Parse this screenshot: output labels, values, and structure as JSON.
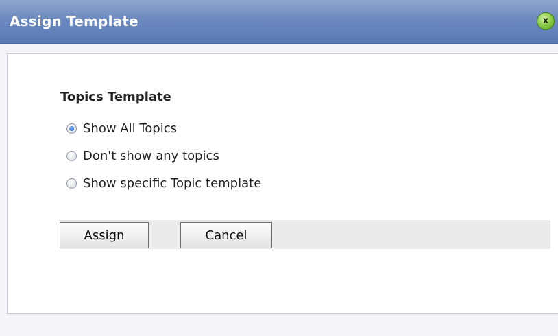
{
  "dialog": {
    "title": "Assign Template",
    "close_label": "x"
  },
  "section": {
    "title": "Topics Template",
    "options": [
      {
        "label": "Show All Topics",
        "checked": true
      },
      {
        "label": "Don't show any topics",
        "checked": false
      },
      {
        "label": "Show specific Topic template",
        "checked": false
      }
    ]
  },
  "buttons": {
    "assign": "Assign",
    "cancel": "Cancel"
  },
  "colors": {
    "titlebar": "#6c89bf",
    "radio_selected": "#2f6fd8",
    "close_button": "#8fcf4a"
  }
}
